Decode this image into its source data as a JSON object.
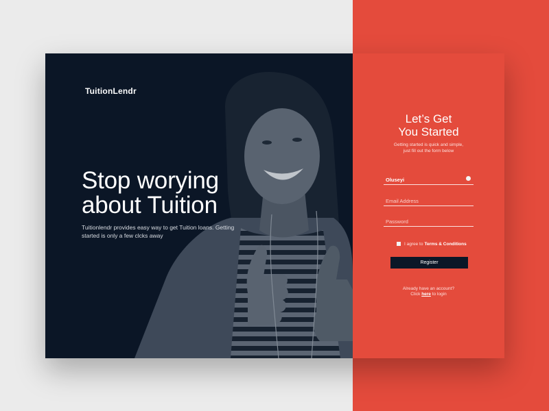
{
  "brand": {
    "name": "TuitionLendr"
  },
  "hero": {
    "headline": "Stop worying about Tuition",
    "description": "Tuitionlendr provides easy way to get Tuition loans. Getting started is only a few clcks away"
  },
  "signup": {
    "title_line1": "Let’s Get",
    "title_line2": "You Started",
    "subtitle_line1": "Getting started is quick and simple,",
    "subtitle_line2": "just fill out the form below",
    "fields": {
      "name_value": "Oluseyi",
      "email_placeholder": "Email Address",
      "password_placeholder": "Password"
    },
    "agree_prefix": "I agree to",
    "terms_label": "Terms & Conditions",
    "register_label": "Register",
    "login_line1": "Already have an account?",
    "login_prefix": "Click",
    "login_link": "here",
    "login_suffix": "to login"
  },
  "colors": {
    "accent": "#e44b3c",
    "dark": "#0b1727",
    "page_background": "#ebebeb"
  },
  "icons": {
    "avatar_placeholder": "person-photo",
    "field_status": "status-dot-icon"
  }
}
